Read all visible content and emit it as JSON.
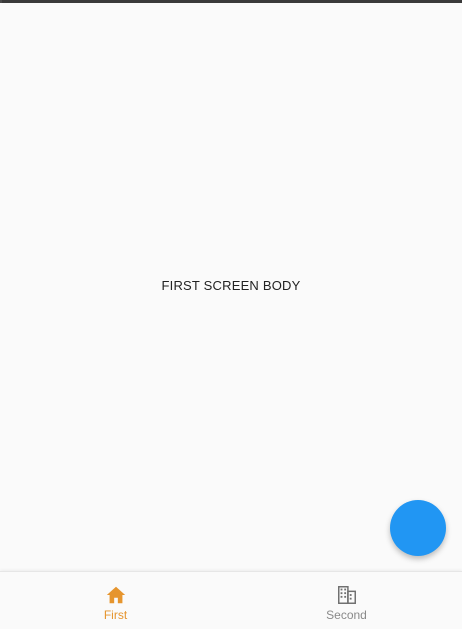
{
  "screen": {
    "body_text": "FIRST SCREEN BODY"
  },
  "fab": {
    "color": "#2196f3"
  },
  "bottom_nav": {
    "items": [
      {
        "label": "First",
        "icon": "home-icon",
        "active": true,
        "color": "#e6952e"
      },
      {
        "label": "Second",
        "icon": "building-icon",
        "active": false,
        "color": "#8a8a8a"
      }
    ]
  }
}
